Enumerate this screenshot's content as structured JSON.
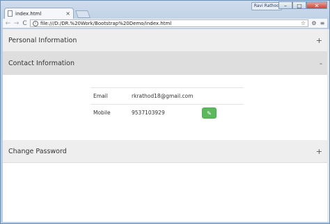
{
  "window": {
    "user_badge": "Ravi Rathod",
    "controls": {
      "minimize": "–",
      "maximize": "□",
      "close": "✕"
    }
  },
  "browser": {
    "tab_title": "index.html",
    "tab_close": "×",
    "url": "file:///D:/DR.%20Work/Bootstrap%20Demo/index.html",
    "nav": {
      "back": "←",
      "forward": "→",
      "reload": "C"
    },
    "star": "☆",
    "extension": "⚙",
    "menu": "≡"
  },
  "page": {
    "panels": {
      "personal": {
        "title": "Personal Information",
        "toggle": "+"
      },
      "contact": {
        "title": "Contact Information",
        "toggle": "-"
      },
      "password": {
        "title": "Change Password",
        "toggle": "+"
      }
    },
    "contact": {
      "rows": [
        {
          "label": "Email",
          "value": "rkrathod18@gmail.com"
        },
        {
          "label": "Mobile",
          "value": "9537103929",
          "edit_icon": "✎"
        }
      ]
    }
  },
  "colors": {
    "success": "#5cb85c",
    "panel_header": "#eeeeee",
    "panel_header_active": "#dedede"
  }
}
